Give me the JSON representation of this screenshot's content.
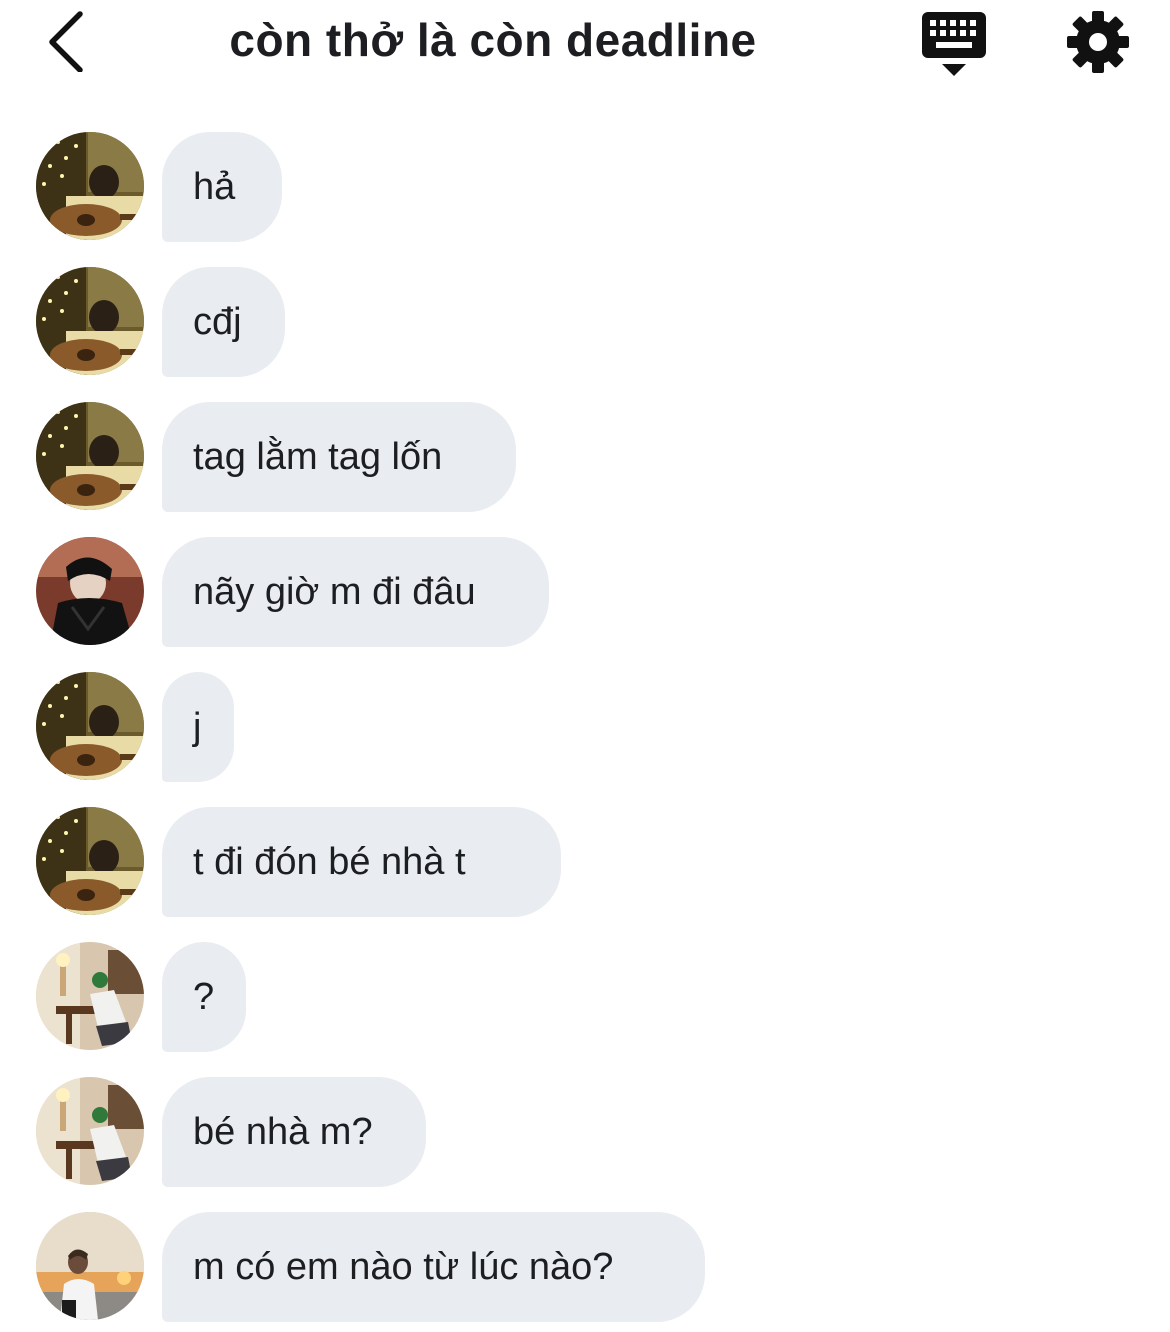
{
  "header": {
    "title": "còn thở là còn deadline",
    "back_icon": "chevron-left-icon",
    "keyboard_icon": "keyboard-hide-icon",
    "settings_icon": "gear-icon"
  },
  "colors": {
    "bubble": "#e9ecf0",
    "text": "#1c1e21",
    "background": "#ffffff"
  },
  "messages": [
    {
      "sender": "guitar",
      "text": "hả"
    },
    {
      "sender": "guitar",
      "text": "cđj"
    },
    {
      "sender": "guitar",
      "text": "tag lằm tag lốn"
    },
    {
      "sender": "dark",
      "text": "nãy giờ m đi đâu"
    },
    {
      "sender": "guitar",
      "text": "j"
    },
    {
      "sender": "guitar",
      "text": "t đi đón bé nhà t"
    },
    {
      "sender": "room",
      "text": "?"
    },
    {
      "sender": "room",
      "text": "bé nhà m?"
    },
    {
      "sender": "sunset",
      "text": "m có em nào từ lúc nào?"
    }
  ]
}
